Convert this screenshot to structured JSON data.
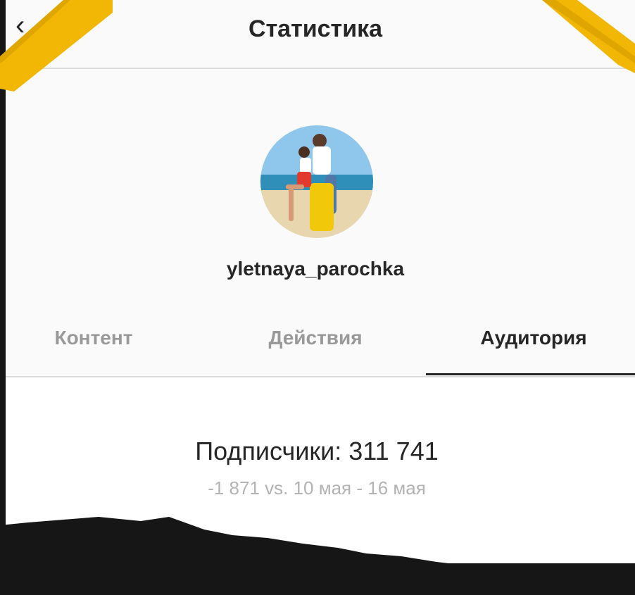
{
  "header": {
    "title": "Статистика",
    "back_icon": "chevron-left-icon"
  },
  "profile": {
    "username": "yletnaya_parochka",
    "avatar": "profile-photo"
  },
  "tabs": [
    {
      "label": "Контент",
      "active": false
    },
    {
      "label": "Действия",
      "active": false
    },
    {
      "label": "Аудитория",
      "active": true
    }
  ],
  "audience": {
    "followers": "Подписчики: 311 741",
    "change": "-1 871 vs. 10 мая - 16 мая"
  },
  "colors": {
    "text": "#262626",
    "muted": "#999999",
    "tape": "#f2b705",
    "background": "#161616"
  }
}
